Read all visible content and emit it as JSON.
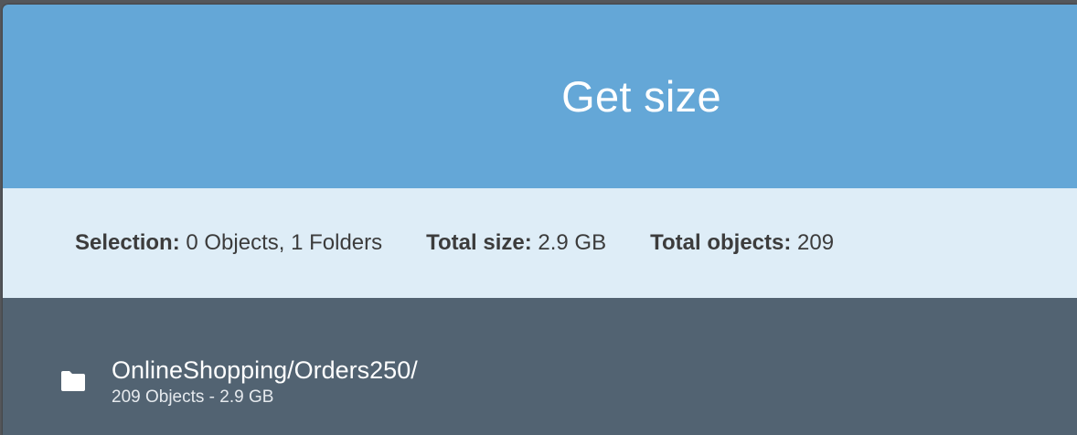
{
  "dialog": {
    "title": "Get size"
  },
  "summary": {
    "selection_label": "Selection:",
    "selection_value": "0 Objects, 1 Folders",
    "total_size_label": "Total size:",
    "total_size_value": "2.9 GB",
    "total_objects_label": "Total objects:",
    "total_objects_value": "209"
  },
  "items": [
    {
      "icon": "folder-icon",
      "name": "OnlineShopping/Orders250/",
      "details": "209 Objects - 2.9 GB"
    }
  ],
  "colors": {
    "header_bg": "#64a7d7",
    "summary_bg": "#deedf7",
    "list_bg": "#526372"
  }
}
